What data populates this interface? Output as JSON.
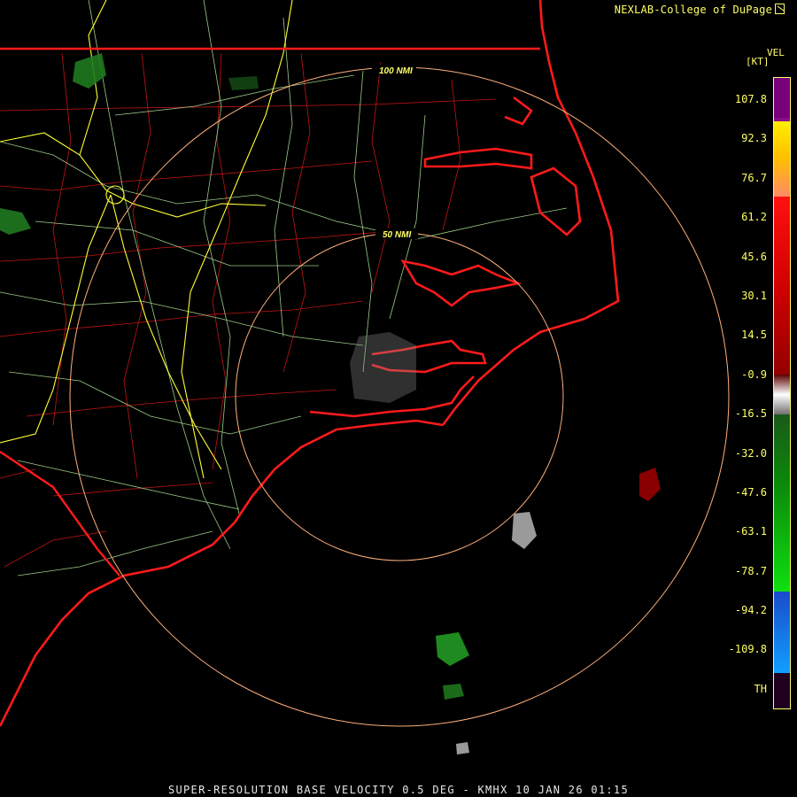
{
  "credit": "NEXLAB-College of DuPage",
  "credit_icon": "external-link-icon",
  "product_code": "VEL",
  "unit": "[KT]",
  "range_rings": [
    "50 NMI",
    "100 NMI"
  ],
  "legend": {
    "labels": [
      "107.8",
      "92.3",
      "76.7",
      "61.2",
      "45.6",
      "30.1",
      "14.5",
      "-0.9",
      "-16.5",
      "-32.0",
      "-47.6",
      "-63.1",
      "-78.7",
      "-94.2",
      "-109.8",
      "TH"
    ],
    "segments": [
      {
        "color": "#7a007a"
      },
      {
        "color": "#8a0d8a"
      },
      {
        "color": "#ffee00"
      },
      {
        "color": "#ffc000"
      },
      {
        "color": "#ff8a66"
      },
      {
        "color": "#ff1010"
      },
      {
        "color": "#d00000"
      },
      {
        "color": "#a00000"
      },
      {
        "color": "#6a0000"
      },
      {
        "color": "#c8c8c8"
      },
      {
        "color": "#1a5a1a"
      },
      {
        "color": "#0a8a0a"
      },
      {
        "color": "#10e010"
      },
      {
        "color": "#1a4acc"
      },
      {
        "color": "#10a0ff"
      },
      {
        "color": "#200020"
      }
    ]
  },
  "colors": {
    "coast": "#ff1a1a",
    "county": "#d01a1a",
    "road": "#ccff99",
    "interstate": "#ffff33",
    "ring": "#ffb07a"
  },
  "footer": "SUPER-RESOLUTION BASE VELOCITY 0.5 DEG - KMHX 10 JAN 26 01:15"
}
